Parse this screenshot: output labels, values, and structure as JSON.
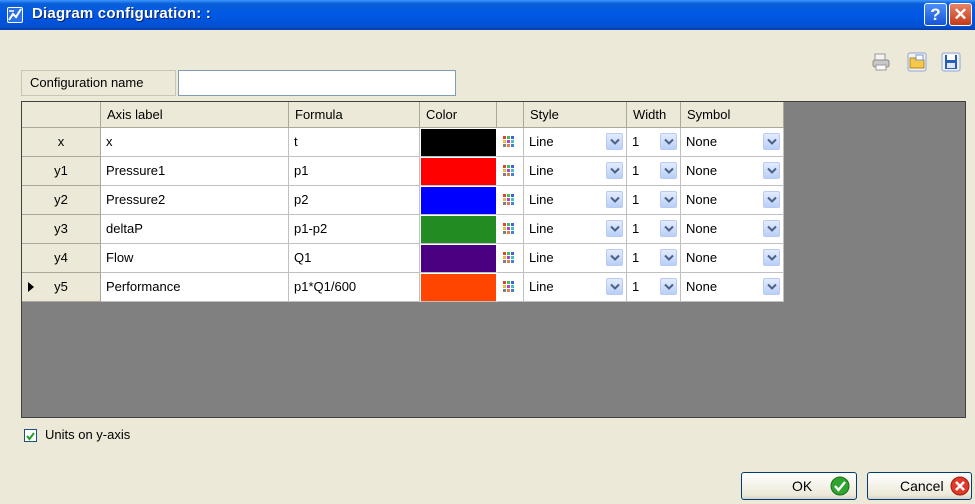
{
  "window": {
    "title": "Diagram configuration:  :",
    "help_label": "?",
    "close_label": "✕"
  },
  "toolbar_icons": [
    "print-icon",
    "open-folder-icon",
    "save-disk-icon"
  ],
  "config": {
    "name_label": "Configuration name",
    "name_value": ""
  },
  "grid": {
    "headers": {
      "axis_label": "Axis label",
      "formula": "Formula",
      "color": "Color",
      "style": "Style",
      "width": "Width",
      "symbol": "Symbol"
    },
    "rows": [
      {
        "id": "x",
        "axis_label": "x",
        "formula": "t",
        "color": "#000000",
        "style": "Line",
        "width": "1",
        "symbol": "None"
      },
      {
        "id": "y1",
        "axis_label": "Pressure1",
        "formula": "p1",
        "color": "#ff0000",
        "style": "Line",
        "width": "1",
        "symbol": "None"
      },
      {
        "id": "y2",
        "axis_label": "Pressure2",
        "formula": "p2",
        "color": "#0000ff",
        "style": "Line",
        "width": "1",
        "symbol": "None"
      },
      {
        "id": "y3",
        "axis_label": "deltaP",
        "formula": "p1-p2",
        "color": "#228b22",
        "style": "Line",
        "width": "1",
        "symbol": "None"
      },
      {
        "id": "y4",
        "axis_label": "Flow",
        "formula": "Q1",
        "color": "#4b0082",
        "style": "Line",
        "width": "1",
        "symbol": "None"
      },
      {
        "id": "y5",
        "axis_label": "Performance",
        "formula": "p1*Q1/600",
        "color": "#ff4500",
        "style": "Line",
        "width": "1",
        "symbol": "None",
        "current": true
      }
    ]
  },
  "units_checkbox": {
    "label": "Units on y-axis",
    "checked": true
  },
  "buttons": {
    "ok": "OK",
    "cancel": "Cancel"
  }
}
